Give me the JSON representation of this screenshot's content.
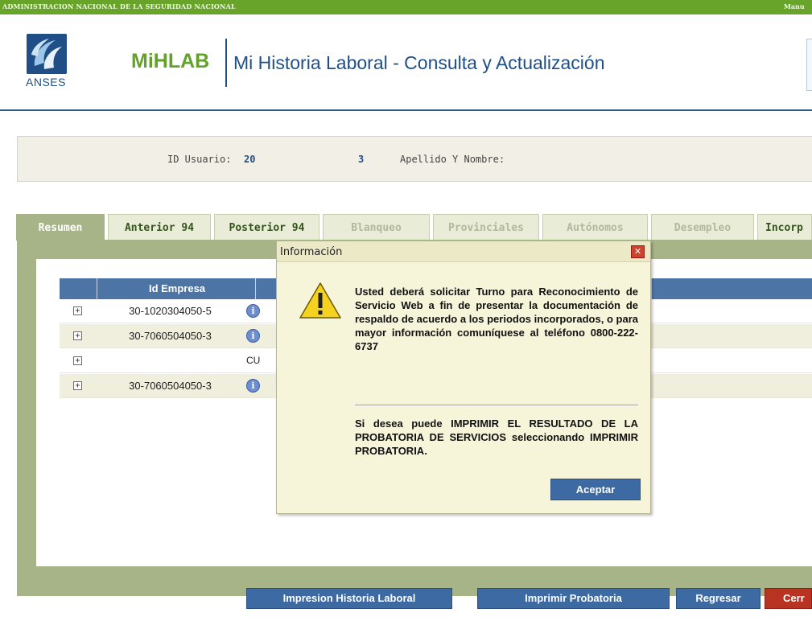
{
  "topbar": {
    "agency": "ADMINISTRACION NACIONAL DE LA SEGURIDAD NACIONAL",
    "manual": "Manu"
  },
  "header": {
    "logo_text": "ANSES",
    "brand": "MiHLAB",
    "title": "Mi Historia Laboral - Consulta y Actualización"
  },
  "user": {
    "id_label": "ID Usuario:",
    "id_part1": "20",
    "id_part2": "3",
    "name_label": "Apellido Y Nombre:"
  },
  "tabs": [
    {
      "label": "Resumen",
      "active": true
    },
    {
      "label": "Anterior 94"
    },
    {
      "label": "Posterior 94"
    },
    {
      "label": "Blanqueo",
      "dim": true
    },
    {
      "label": "Provinciales",
      "dim": true
    },
    {
      "label": "Autónomos",
      "dim": true
    },
    {
      "label": "Desempleo",
      "dim": true
    },
    {
      "label": "Incorp"
    }
  ],
  "grid": {
    "headers": [
      "Id Empresa"
    ],
    "rows": [
      {
        "id": "30-1020304050-5",
        "cell": "info",
        "alt": false
      },
      {
        "id": "30-7060504050-3",
        "cell": "info",
        "alt": true
      },
      {
        "id": "",
        "cell": "CU",
        "alt": false
      },
      {
        "id": "30-7060504050-3",
        "cell": "info",
        "alt": true
      }
    ]
  },
  "buttons": {
    "impresion": "Impresion Historia Laboral",
    "imprimir": "Imprimir Probatoria",
    "regresar": "Regresar",
    "cerrar": "Cerr"
  },
  "dialog": {
    "title": "Información",
    "message": "Usted deberá solicitar Turno para Reconocimiento de Servicio Web a fin de presentar la documentación de respaldo de acuerdo a los periodos incorporados, o para mayor información comuníquese al teléfono 0800-222-6737",
    "message2": "Si desea puede IMPRIMIR EL RESULTADO DE LA PROBATORIA DE SERVICIOS seleccionando IMPRIMIR PROBATORIA.",
    "ok_label": "Aceptar"
  },
  "colors": {
    "accent_green": "#68a42a",
    "brand_blue": "#1f4f86",
    "button_blue": "#3e6aa4",
    "close_red": "#b93323"
  }
}
